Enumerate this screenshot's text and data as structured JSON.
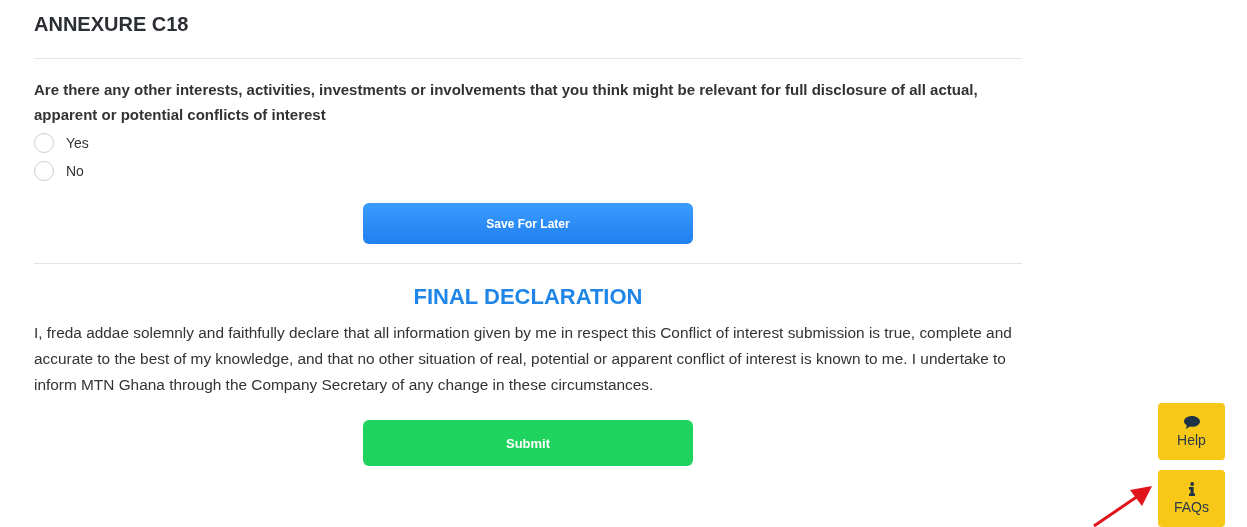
{
  "heading": "ANNEXURE C18",
  "question": "Are there any other interests, activities, investments or involvements that you think might be relevant for full disclosure of all actual, apparent or potential conflicts of interest",
  "options": [
    {
      "label": "Yes",
      "selected": false
    },
    {
      "label": "No",
      "selected": false
    }
  ],
  "save_button": "Save For Later",
  "declaration": {
    "title": "FINAL DECLARATION",
    "text": "I, freda addae solemnly and faithfully declare that all information given by me in respect this Conflict of interest submission is true, complete and accurate to the best of my knowledge, and that no other situation of real, potential or apparent conflict of interest is known to me. I undertake to inform MTN Ghana through the Company Secretary of any change in these circumstances."
  },
  "submit_button": "Submit",
  "floating_buttons": [
    {
      "kind": "help",
      "label": "Help"
    },
    {
      "kind": "faqs",
      "label": "FAQs"
    }
  ]
}
